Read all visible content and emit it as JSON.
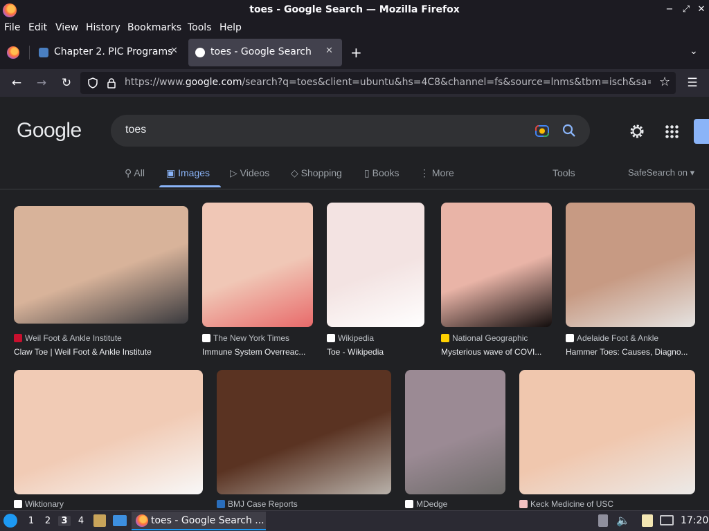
{
  "window": {
    "title": "toes - Google Search — Mozilla Firefox"
  },
  "menubar": {
    "items": [
      "File",
      "Edit",
      "View",
      "History",
      "Bookmarks",
      "Tools",
      "Help"
    ]
  },
  "tabs": [
    {
      "label": "Chapter 2. PIC Programs",
      "favicon_color": "#4a7fc1"
    },
    {
      "label": "toes - Google Search",
      "favicon_color": "#ffffff"
    }
  ],
  "navbar": {
    "url_prefix": "https://www.",
    "url_domain": "google.com",
    "url_rest": "/search?q=toes&client=ubuntu&hs=4C8&channel=fs&source=lnms&tbm=isch&sa="
  },
  "google": {
    "logo": "Google",
    "query": "toes",
    "tabs": [
      "All",
      "Images",
      "Videos",
      "Shopping",
      "Books",
      "More"
    ],
    "active_tab": "Images",
    "tools": "Tools",
    "safesearch": "SafeSearch on"
  },
  "results": [
    {
      "source": "Weil Foot & Ankle Institute",
      "caption": "Claw Toe | Weil Foot & Ankle Institute",
      "source_color": "#c8102e",
      "tone": [
        "#d8b39a",
        "#3a3a3e"
      ]
    },
    {
      "source": "The New York Times",
      "caption": "Immune System Overreac...",
      "source_color": "#ffffff",
      "tone": [
        "#f0c7b6",
        "#e86a6a"
      ]
    },
    {
      "source": "Wikipedia",
      "caption": "Toe - Wikipedia",
      "source_color": "#ffffff",
      "tone": [
        "#f3e3e2",
        "#ffffff"
      ]
    },
    {
      "source": "National Geographic",
      "caption": "Mysterious wave of COVI...",
      "source_color": "#ffd100",
      "tone": [
        "#e9b4a7",
        "#120d0d"
      ]
    },
    {
      "source": "Adelaide Foot & Ankle",
      "caption": "Hammer Toes: Causes, Diagno...",
      "source_color": "#ffffff",
      "tone": [
        "#c79a83",
        "#e5e3e1"
      ]
    },
    {
      "source": "Wiktionary",
      "caption": "",
      "source_color": "#ffffff",
      "tone": [
        "#f1cbb5",
        "#f8f8f8"
      ]
    },
    {
      "source": "BMJ Case Reports",
      "caption": "",
      "source_color": "#2a6ebb",
      "tone": [
        "#5a3322",
        "#b8b1aa"
      ]
    },
    {
      "source": "MDedge",
      "caption": "",
      "source_color": "#ffffff",
      "tone": [
        "#9b8a94",
        "#6c6a68"
      ]
    },
    {
      "source": "Keck Medicine of USC",
      "caption": "",
      "source_color": "#f3c1c1",
      "tone": [
        "#f0c7ae",
        "#eceae8"
      ]
    }
  ],
  "taskbar": {
    "workspaces": [
      "1",
      "2",
      "3",
      "4"
    ],
    "current_workspace": "3",
    "window_label": "toes - Google Search ...",
    "clock": "17:20"
  }
}
